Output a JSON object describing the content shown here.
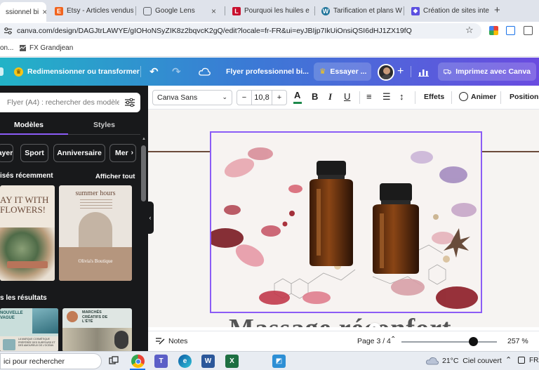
{
  "browser": {
    "tabs": [
      {
        "label": "ssionnel bi",
        "favicon": "canva-favicon",
        "active": true
      },
      {
        "label": "Etsy - Articles vendus",
        "favicon": "etsy-favicon",
        "active": false
      },
      {
        "label": "Google Lens",
        "favicon": "google-lens-favicon",
        "active": false
      },
      {
        "label": "Pourquoi les huiles e",
        "favicon": "larousse-favicon",
        "active": false
      },
      {
        "label": "Tarification et plans W",
        "favicon": "wordpress-favicon",
        "active": false
      },
      {
        "label": "Création de sites inte",
        "favicon": "site-builder-favicon",
        "active": false
      }
    ],
    "url": "canva.com/design/DAGJtrLAWYE/gIOHoNSyZIK8z2bqvcK2gQ/edit?locale=fr-FR&ui=eyJBIjp7IkUiOnsiQSI6dHJ1ZX19fQ",
    "bookmarks": [
      {
        "label": "on..."
      },
      {
        "label": "FX Grandjean"
      }
    ]
  },
  "canva": {
    "resize_label": "Redimensionner ou transformer",
    "doc_title": "Flyer professionnel bi...",
    "try_label": "Essayer ...",
    "print_label": "Imprimez avec Canva"
  },
  "panel": {
    "search_placeholder": "Flyer (A4) : rechercher des modèles",
    "tabs": [
      "Modèles",
      "Styles"
    ],
    "chips": [
      "ayer",
      "Sport",
      "Anniversaire",
      "Mer"
    ],
    "recent_title": "isés récemment",
    "show_all": "Afficher tout",
    "results_title": "s les résultats",
    "thumb1_text": "AY IT WITH FLOWERS!",
    "thumb2_title": "summer hours",
    "thumb2_brand": "Olivia's Boutique",
    "thumb3_title": "NOUVELLE\nVAGUE",
    "thumb3_text": "LA MARQUE COSMÉTIQUE PRÉFÉRÉE DES SURFEURS ET DES AMOUREUX DE L'OCÉAN",
    "thumb4_title": "MARCHÉS CRÉATIFS DE L'ÉTÉ"
  },
  "toolbar": {
    "font": "Canva Sans",
    "minus": "−",
    "size": "10,8",
    "plus": "+",
    "effects": "Effets",
    "animate": "Animer",
    "position": "Position"
  },
  "canvas": {
    "title_partial": "Massage réconfort"
  },
  "bottom": {
    "notes": "Notes",
    "page": "Page 3 / 4",
    "zoom": "257 %",
    "zoom_fraction": 0.75
  },
  "taskbar": {
    "search": "ici pour rechercher",
    "weather": "21°C  Ciel couvert",
    "lang": "FRA"
  },
  "colors": {
    "accent": "#8b5cf6",
    "canva_gradient_start": "#22b3c7",
    "canva_gradient_end": "#6a4be0",
    "panel_bg": "#18191b"
  }
}
